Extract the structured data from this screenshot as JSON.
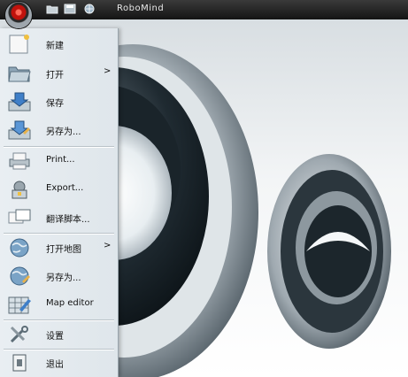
{
  "window": {
    "title": "RoboMind"
  },
  "quick_access": [
    {
      "icon": "open-folder-icon"
    },
    {
      "icon": "save-icon"
    },
    {
      "icon": "world-icon"
    }
  ],
  "menu": {
    "items": [
      {
        "label": "新建",
        "icon": "new-document-icon",
        "submenu": false
      },
      {
        "label": "打开",
        "icon": "open-folder-icon",
        "submenu": true,
        "arrow": ">"
      },
      {
        "label": "保存",
        "icon": "save-icon",
        "submenu": false
      },
      {
        "label": "另存为...",
        "icon": "save-as-icon",
        "submenu": false
      },
      {
        "label": "Print...",
        "icon": "printer-icon",
        "submenu": false
      },
      {
        "label": "Export...",
        "icon": "export-icon",
        "submenu": false
      },
      {
        "label": "翻译脚本...",
        "icon": "translate-script-icon",
        "submenu": false
      },
      {
        "label": "打开地图",
        "icon": "open-map-icon",
        "submenu": true,
        "arrow": ">"
      },
      {
        "label": "另存为...",
        "icon": "save-map-as-icon",
        "submenu": false
      },
      {
        "label": "Map editor",
        "icon": "map-editor-icon",
        "submenu": false
      },
      {
        "label": "设置",
        "icon": "settings-icon",
        "submenu": false
      },
      {
        "label": "退出",
        "icon": "exit-icon",
        "submenu": false
      }
    ]
  },
  "colors": {
    "titlebar": "#1c1c1c",
    "menu_bg": "#e4eaee",
    "orb_red": "#c0120c"
  }
}
